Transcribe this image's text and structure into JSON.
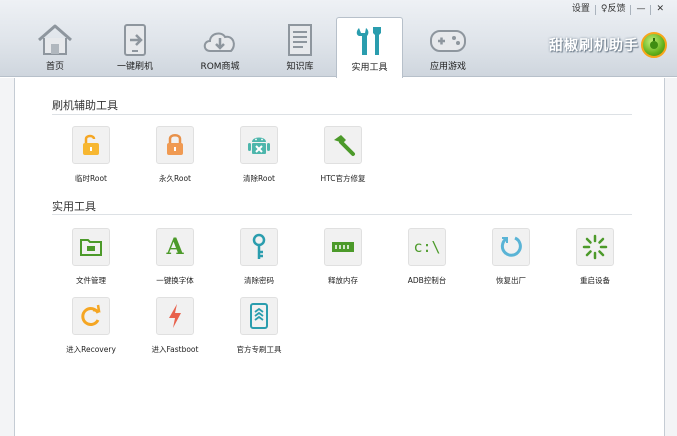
{
  "window": {
    "controls": [
      "设置",
      "♀反馈",
      "—",
      "✕"
    ]
  },
  "tabs": [
    {
      "label": "首页",
      "icon": "home-icon"
    },
    {
      "label": "一键刷机",
      "icon": "phone-flash-icon"
    },
    {
      "label": "ROM商城",
      "icon": "cloud-download-icon"
    },
    {
      "label": "知识库",
      "icon": "document-icon"
    },
    {
      "label": "实用工具",
      "icon": "tools-icon",
      "active": true
    },
    {
      "label": "应用游戏",
      "icon": "gamepad-icon"
    }
  ],
  "brand": {
    "name": "甜椒刷机助手"
  },
  "sections": [
    {
      "title": "刷机辅助工具",
      "tools": [
        {
          "label": "临时Root",
          "icon": "lock-open-icon"
        },
        {
          "label": "永久Root",
          "icon": "lock-icon"
        },
        {
          "label": "清除Root",
          "icon": "android-icon"
        },
        {
          "label": "HTC官方修复",
          "icon": "hammer-icon"
        }
      ]
    },
    {
      "title": "实用工具",
      "tools": [
        {
          "label": "文件管理",
          "icon": "folder-icon"
        },
        {
          "label": "一键换字体",
          "icon": "font-icon"
        },
        {
          "label": "清除密码",
          "icon": "key-icon"
        },
        {
          "label": "释放内存",
          "icon": "memory-icon"
        },
        {
          "label": "ADB控制台",
          "icon": "console-icon"
        },
        {
          "label": "恢复出厂",
          "icon": "restore-icon"
        },
        {
          "label": "重启设备",
          "icon": "reboot-icon"
        },
        {
          "label": "进入Recovery",
          "icon": "recovery-icon"
        },
        {
          "label": "进入Fastboot",
          "icon": "lightning-icon"
        },
        {
          "label": "官方专刷工具",
          "icon": "official-tool-icon"
        }
      ]
    }
  ],
  "colors": {
    "accent_green": "#4c9a2a",
    "accent_orange": "#f5a623",
    "accent_teal": "#2a9dae",
    "flash_red": "#e8614c"
  }
}
